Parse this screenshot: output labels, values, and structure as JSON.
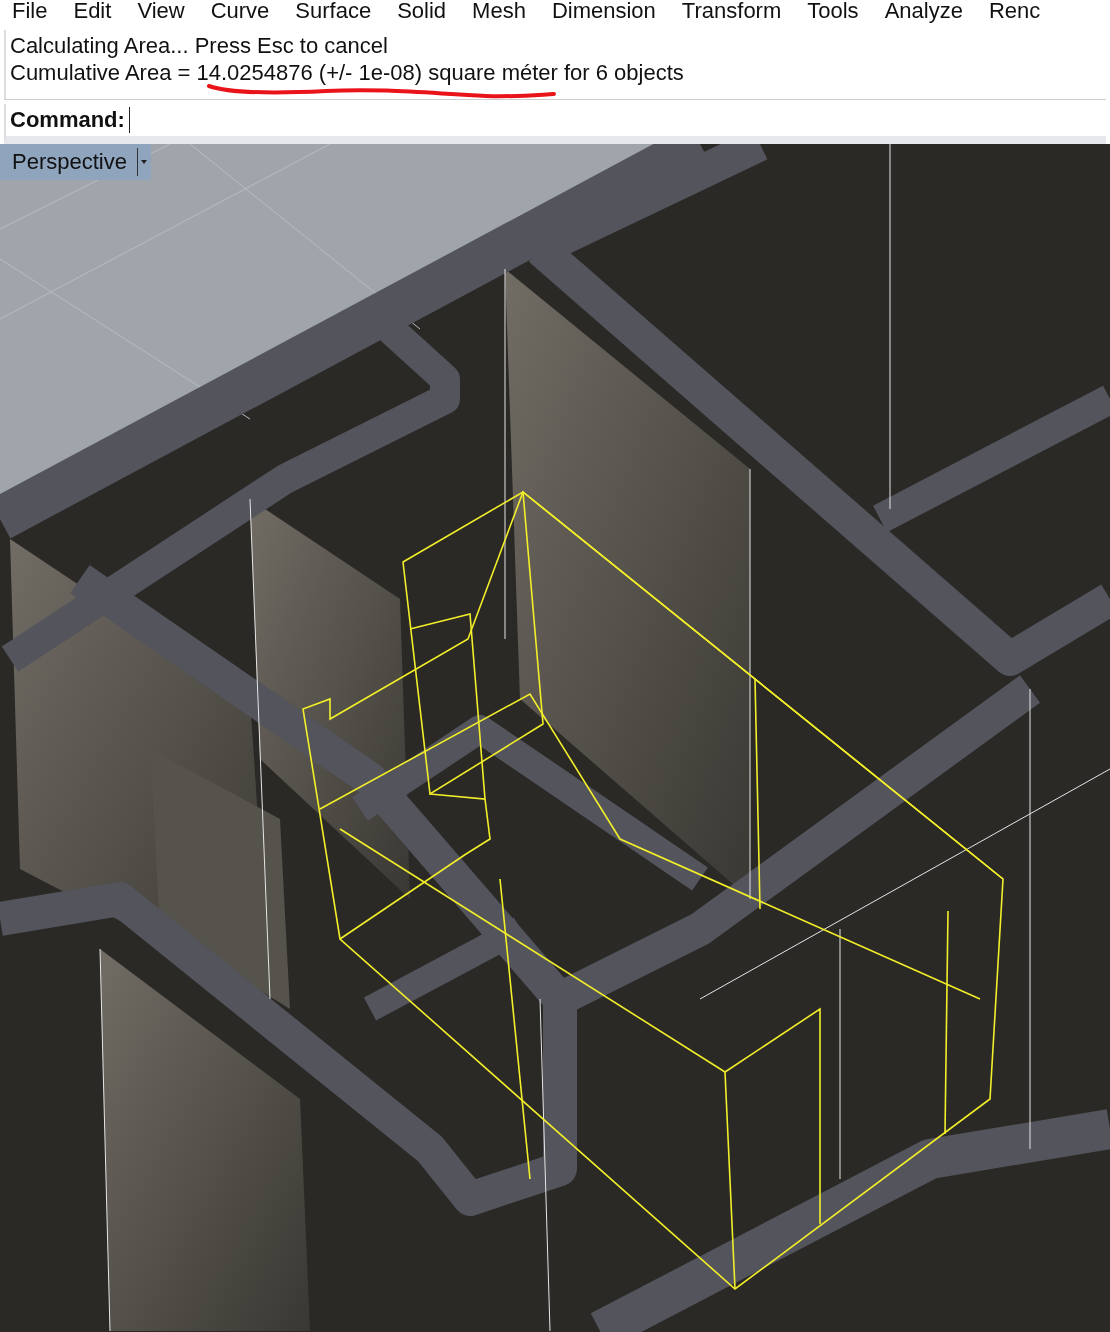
{
  "menu_bar": {
    "items": [
      {
        "label": "File"
      },
      {
        "label": "Edit"
      },
      {
        "label": "View"
      },
      {
        "label": "Curve"
      },
      {
        "label": "Surface"
      },
      {
        "label": "Solid"
      },
      {
        "label": "Mesh"
      },
      {
        "label": "Dimension"
      },
      {
        "label": "Transform"
      },
      {
        "label": "Tools"
      },
      {
        "label": "Analyze"
      },
      {
        "label": "Renc"
      }
    ]
  },
  "command_history": {
    "lines": [
      "Calculating Area... Press Esc to cancel",
      "Cumulative Area = 14.0254876 (+/- 1e-08) square méter for 6 objects"
    ]
  },
  "command_line": {
    "prompt": "Command:"
  },
  "viewport": {
    "title": "Perspective"
  }
}
